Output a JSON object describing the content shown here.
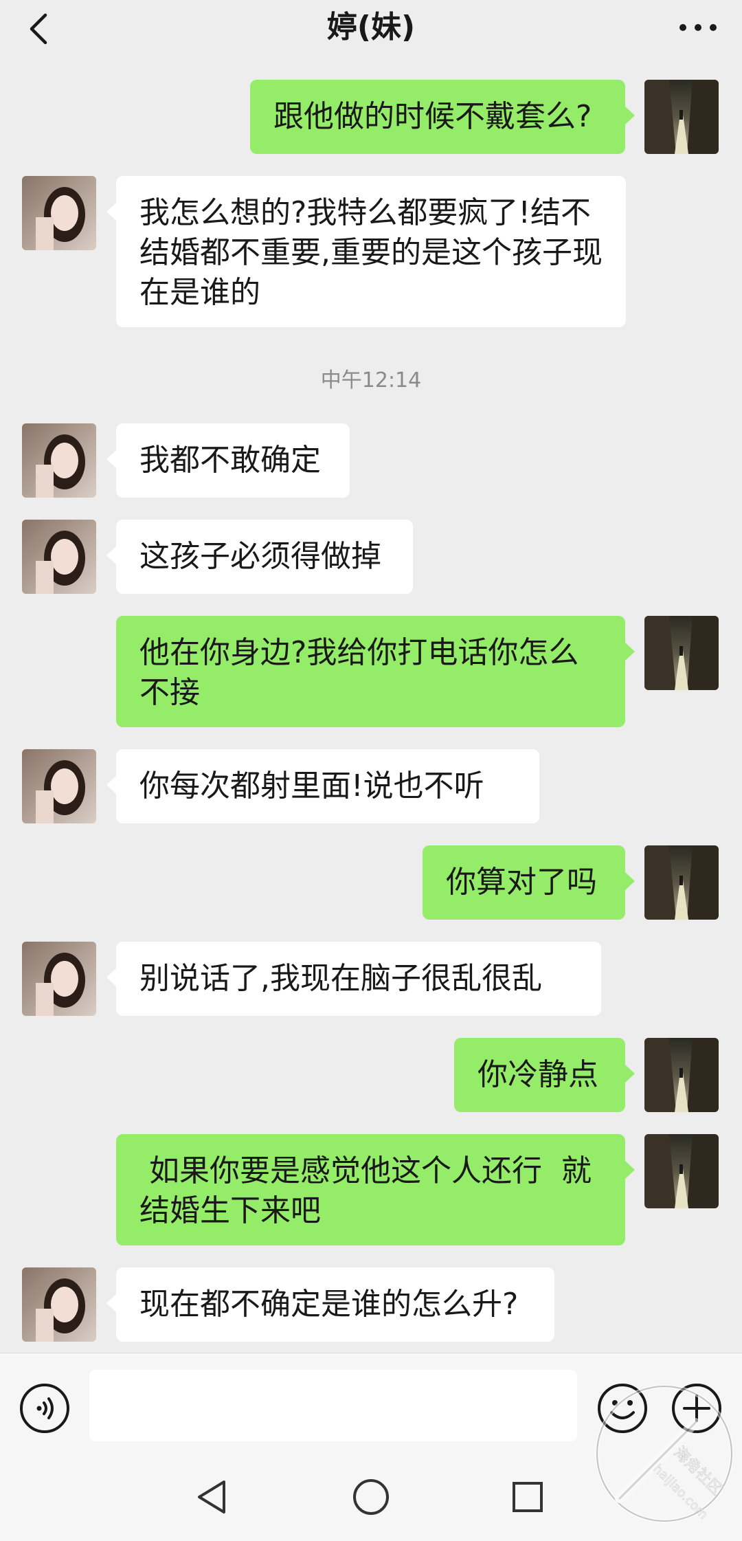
{
  "header": {
    "title": "婷(妹)",
    "back_icon": "chevron-left-icon",
    "more_icon": "more-horizontal-icon"
  },
  "colors": {
    "background": "#ededed",
    "sent_bubble": "#95ec69",
    "recv_bubble": "#ffffff",
    "timestamp": "#8a8a8a"
  },
  "timestamp": "中午12:14",
  "messages": [
    {
      "from": "me",
      "text": "跟他做的时候不戴套么?"
    },
    {
      "from": "her",
      "text": "我怎么想的?我特么都要疯了!结不结婚都不重要,重要的是这个孩子现在是谁的"
    },
    {
      "from": "her",
      "text": "我都不敢确定"
    },
    {
      "from": "her",
      "text": "这孩子必须得做掉"
    },
    {
      "from": "me",
      "text": "他在你身边?我给你打电话你怎么不接"
    },
    {
      "from": "her",
      "text": "你每次都射里面!说也不听"
    },
    {
      "from": "me",
      "text": "你算对了吗"
    },
    {
      "from": "her",
      "text": "别说话了,我现在脑子很乱很乱"
    },
    {
      "from": "me",
      "text": "你冷静点"
    },
    {
      "from": "me",
      "text": " 如果你要是感觉他这个人还行  就结婚生下来吧"
    },
    {
      "from": "her",
      "text": "现在都不确定是谁的怎么升?"
    }
  ],
  "input": {
    "value": "",
    "voice_icon": "voice-icon",
    "emoji_icon": "emoji-icon",
    "plus_icon": "plus-icon"
  },
  "navbar": {
    "back_icon": "triangle-back-icon",
    "home_icon": "circle-home-icon",
    "recents_icon": "square-recents-icon"
  },
  "watermark": {
    "line1": "海角社区",
    "line2": "haijiao.com"
  }
}
